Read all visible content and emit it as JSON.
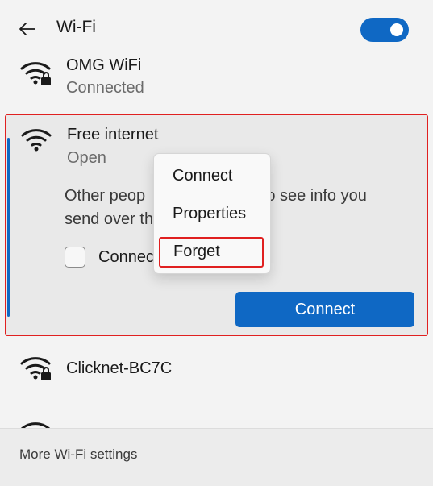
{
  "header": {
    "title": "Wi-Fi",
    "back_icon": "back-arrow-icon",
    "wifi_toggle_on": true,
    "toggle_color": "#0f68c4"
  },
  "networks": [
    {
      "name": "OMG WiFi",
      "status": "Connected",
      "secured": true,
      "icon": "wifi-lock-icon"
    },
    {
      "name": "Free internet",
      "status": "Open",
      "secured": false,
      "icon": "wifi-icon",
      "description_line1": "Other peop",
      "description_line1_tail": "e to see info you",
      "description_line2": "send over th",
      "auto_connect_label": "Connec",
      "auto_connect_checked": false,
      "connect_label": "Connect"
    },
    {
      "name": "Clicknet-BC7C",
      "secured": true,
      "icon": "wifi-lock-icon"
    }
  ],
  "context_menu": {
    "items": [
      "Connect",
      "Properties",
      "Forget"
    ],
    "highlighted": "Forget",
    "highlight_color": "#e02020"
  },
  "footer": {
    "link": "More Wi-Fi settings"
  },
  "accent_color": "#0f68c4"
}
